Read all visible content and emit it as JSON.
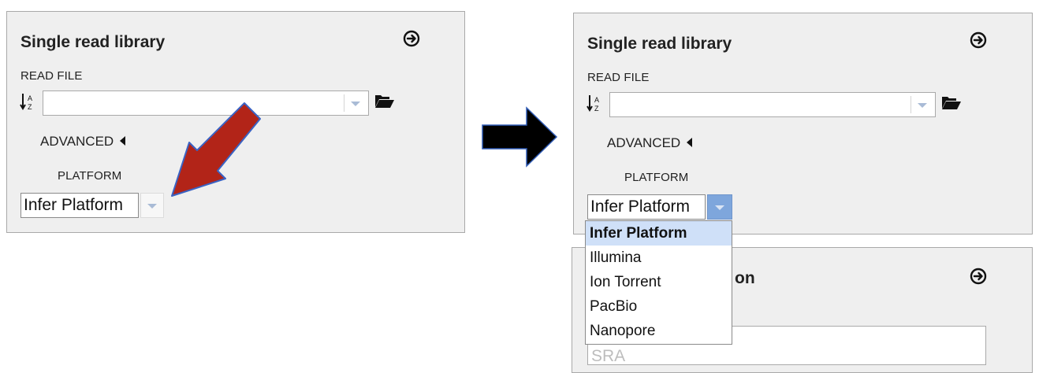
{
  "left_panel": {
    "title": "Single read library",
    "read_file_label": "READ FILE",
    "read_file_value": "",
    "advanced_label": "ADVANCED",
    "platform_label": "PLATFORM",
    "platform_value": "Infer Platform"
  },
  "right_panel": {
    "title": "Single read library",
    "read_file_label": "READ FILE",
    "read_file_value": "",
    "advanced_label": "ADVANCED",
    "platform_label": "PLATFORM",
    "platform_value": "Infer Platform"
  },
  "dropdown": {
    "options": [
      "Infer Platform",
      "Illumina",
      "Ion Torrent",
      "PacBio",
      "Nanopore"
    ],
    "selected": "Infer Platform"
  },
  "bottom_panel": {
    "title_partial": "on",
    "field_partial": "SRA"
  },
  "colors": {
    "highlight_arrow": "#b22418",
    "transition_arrow": "#000000",
    "dropdown_selected_bg": "#cfe0f8",
    "select_button_active": "#7ea6dc"
  }
}
